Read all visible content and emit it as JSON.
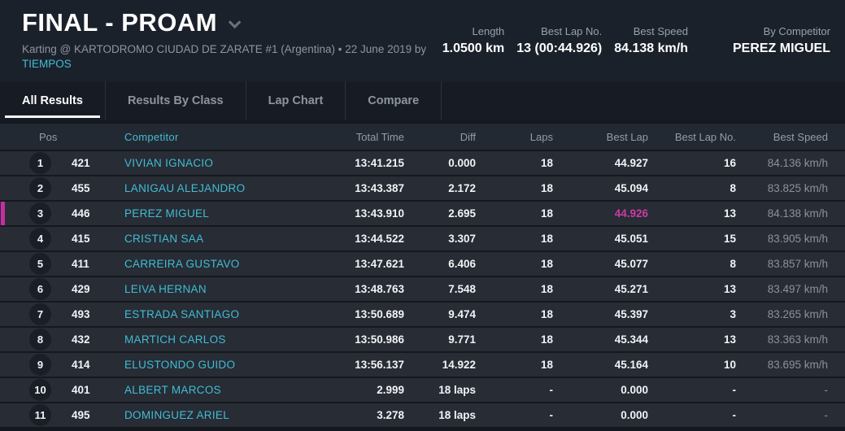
{
  "colors": {
    "accent_cyan": "#41bdd4",
    "highlight_magenta": "#c42e9f",
    "best_lap_magenta_text": "#cc3ba3"
  },
  "header": {
    "title": "FINAL - PROAM",
    "subtitle_prefix": "Karting @ KARTODROMO CIUDAD DE ZARATE #1 (Argentina) • 22 June 2019 by",
    "subtitle_link": "TIEMPOS",
    "stats": [
      {
        "label": "Length",
        "value": "1.0500 km"
      },
      {
        "label": "Best Lap No.",
        "value": "13 (00:44.926)"
      },
      {
        "label": "Best Speed",
        "value": "84.138 km/h"
      },
      {
        "label": "By Competitor",
        "value": "PEREZ MIGUEL"
      }
    ]
  },
  "tabs": [
    {
      "label": "All Results",
      "active": true
    },
    {
      "label": "Results By Class",
      "active": false
    },
    {
      "label": "Lap Chart",
      "active": false
    },
    {
      "label": "Compare",
      "active": false
    }
  ],
  "table": {
    "columns": {
      "pos": "Pos",
      "competitor": "Competitor",
      "total_time": "Total Time",
      "diff": "Diff",
      "laps": "Laps",
      "best_lap": "Best Lap",
      "best_lap_no": "Best Lap No.",
      "best_speed": "Best Speed"
    },
    "rows": [
      {
        "pos": "1",
        "no": "421",
        "competitor": "VIVIAN IGNACIO",
        "total_time": "13:41.215",
        "diff": "0.000",
        "laps": "18",
        "best_lap": "44.927",
        "best_lap_no": "16",
        "best_speed": "84.136 km/h",
        "highlight": false,
        "best_lap_pink": false
      },
      {
        "pos": "2",
        "no": "455",
        "competitor": "LANIGAU ALEJANDRO",
        "total_time": "13:43.387",
        "diff": "2.172",
        "laps": "18",
        "best_lap": "45.094",
        "best_lap_no": "8",
        "best_speed": "83.825 km/h",
        "highlight": false,
        "best_lap_pink": false
      },
      {
        "pos": "3",
        "no": "446",
        "competitor": "PEREZ MIGUEL",
        "total_time": "13:43.910",
        "diff": "2.695",
        "laps": "18",
        "best_lap": "44.926",
        "best_lap_no": "13",
        "best_speed": "84.138 km/h",
        "highlight": true,
        "best_lap_pink": true
      },
      {
        "pos": "4",
        "no": "415",
        "competitor": "CRISTIAN SAA",
        "total_time": "13:44.522",
        "diff": "3.307",
        "laps": "18",
        "best_lap": "45.051",
        "best_lap_no": "15",
        "best_speed": "83.905 km/h",
        "highlight": false,
        "best_lap_pink": false
      },
      {
        "pos": "5",
        "no": "411",
        "competitor": "CARREIRA GUSTAVO",
        "total_time": "13:47.621",
        "diff": "6.406",
        "laps": "18",
        "best_lap": "45.077",
        "best_lap_no": "8",
        "best_speed": "83.857 km/h",
        "highlight": false,
        "best_lap_pink": false
      },
      {
        "pos": "6",
        "no": "429",
        "competitor": "LEIVA HERNAN",
        "total_time": "13:48.763",
        "diff": "7.548",
        "laps": "18",
        "best_lap": "45.271",
        "best_lap_no": "13",
        "best_speed": "83.497 km/h",
        "highlight": false,
        "best_lap_pink": false
      },
      {
        "pos": "7",
        "no": "493",
        "competitor": "ESTRADA SANTIAGO",
        "total_time": "13:50.689",
        "diff": "9.474",
        "laps": "18",
        "best_lap": "45.397",
        "best_lap_no": "3",
        "best_speed": "83.265 km/h",
        "highlight": false,
        "best_lap_pink": false
      },
      {
        "pos": "8",
        "no": "432",
        "competitor": "MARTICH CARLOS",
        "total_time": "13:50.986",
        "diff": "9.771",
        "laps": "18",
        "best_lap": "45.344",
        "best_lap_no": "13",
        "best_speed": "83.363 km/h",
        "highlight": false,
        "best_lap_pink": false
      },
      {
        "pos": "9",
        "no": "414",
        "competitor": "ELUSTONDO GUIDO",
        "total_time": "13:56.137",
        "diff": "14.922",
        "laps": "18",
        "best_lap": "45.164",
        "best_lap_no": "10",
        "best_speed": "83.695 km/h",
        "highlight": false,
        "best_lap_pink": false
      },
      {
        "pos": "10",
        "no": "401",
        "competitor": "ALBERT MARCOS",
        "total_time": "2.999",
        "diff": "18 laps",
        "laps": "-",
        "best_lap": "0.000",
        "best_lap_no": "-",
        "best_speed": "-",
        "highlight": false,
        "best_lap_pink": false
      },
      {
        "pos": "11",
        "no": "495",
        "competitor": "DOMINGUEZ ARIEL",
        "total_time": "3.278",
        "diff": "18 laps",
        "laps": "-",
        "best_lap": "0.000",
        "best_lap_no": "-",
        "best_speed": "-",
        "highlight": false,
        "best_lap_pink": false
      }
    ]
  }
}
